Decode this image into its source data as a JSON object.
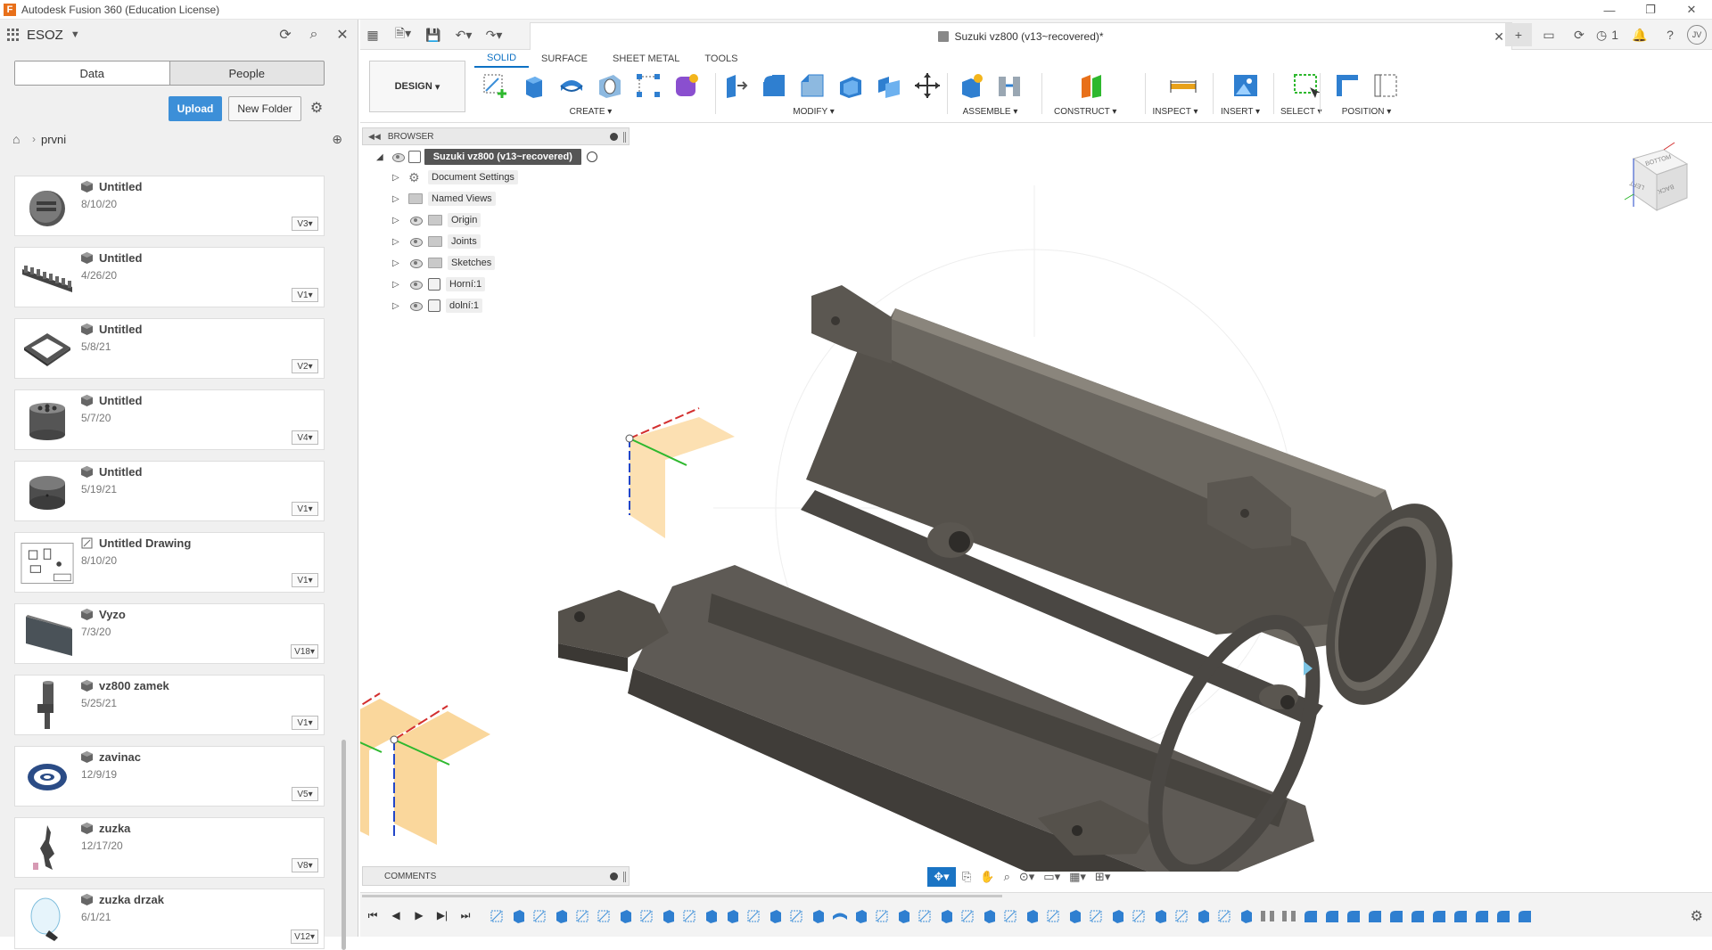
{
  "window": {
    "title": "Autodesk Fusion 360 (Education License)",
    "app_logo": "F",
    "controls": [
      "minimize-icon",
      "restore-icon",
      "close-icon"
    ]
  },
  "data_panel": {
    "team": "ESOZ",
    "tabs": {
      "data": "Data",
      "people": "People"
    },
    "upload": "Upload",
    "new_folder": "New Folder",
    "breadcrumb": "prvni",
    "files": [
      {
        "name": "Untitled",
        "date": "8/10/20",
        "version": "V3",
        "thumb": "disc"
      },
      {
        "name": "Untitled",
        "date": "4/26/20",
        "version": "V1",
        "thumb": "strip"
      },
      {
        "name": "Untitled",
        "date": "5/8/21",
        "version": "V2",
        "thumb": "frame"
      },
      {
        "name": "Untitled",
        "date": "5/7/20",
        "version": "V4",
        "thumb": "cylinder-holes"
      },
      {
        "name": "Untitled",
        "date": "5/19/21",
        "version": "V1",
        "thumb": "cylinder"
      },
      {
        "name": "Untitled Drawing",
        "date": "8/10/20",
        "version": "V1",
        "thumb": "drawing"
      },
      {
        "name": "Vyzo",
        "date": "7/3/20",
        "version": "V18",
        "thumb": "plate"
      },
      {
        "name": "vz800 zamek",
        "date": "5/25/21",
        "version": "V1",
        "thumb": "lock"
      },
      {
        "name": "zavinac",
        "date": "12/9/19",
        "version": "V5",
        "thumb": "at-sign"
      },
      {
        "name": "zuzka",
        "date": "12/17/20",
        "version": "V8",
        "thumb": "figure"
      },
      {
        "name": "zuzka drzak",
        "date": "6/1/21",
        "version": "V12",
        "thumb": "holder"
      }
    ]
  },
  "document": {
    "tab_title": "Suzuki vz800 (v13~recovered)*",
    "notification_count": "1",
    "user_initials": "JV"
  },
  "ribbon": {
    "workspace": "DESIGN",
    "tabs": [
      "SOLID",
      "SURFACE",
      "SHEET METAL",
      "TOOLS"
    ],
    "groups": {
      "create": "CREATE",
      "modify": "MODIFY",
      "assemble": "ASSEMBLE",
      "construct": "CONSTRUCT",
      "inspect": "INSPECT",
      "insert": "INSERT",
      "select": "SELECT",
      "position": "POSITION"
    },
    "accent": "#0d71c4"
  },
  "browser": {
    "header": "BROWSER",
    "root": "Suzuki vz800 (v13~recovered)",
    "items": [
      {
        "label": "Document Settings",
        "icon": "gear-icon"
      },
      {
        "label": "Named Views",
        "icon": "folder-icon"
      },
      {
        "label": "Origin",
        "icon": "folder-icon"
      },
      {
        "label": "Joints",
        "icon": "folder-icon"
      },
      {
        "label": "Sketches",
        "icon": "folder-icon"
      },
      {
        "label": "Horní:1",
        "icon": "component-icon"
      },
      {
        "label": "dolní:1",
        "icon": "component-icon"
      }
    ]
  },
  "viewcube": {
    "faces": [
      "BOTTOM",
      "LEFT",
      "BACK"
    ]
  },
  "comments": {
    "label": "COMMENTS"
  },
  "colors": {
    "model": "#5e5a55",
    "plane": "#f5a623",
    "upload_button": "#3c8fd8",
    "axis_x": "#d32f2f",
    "axis_y": "#2eb82e",
    "axis_z": "#2246c8"
  }
}
